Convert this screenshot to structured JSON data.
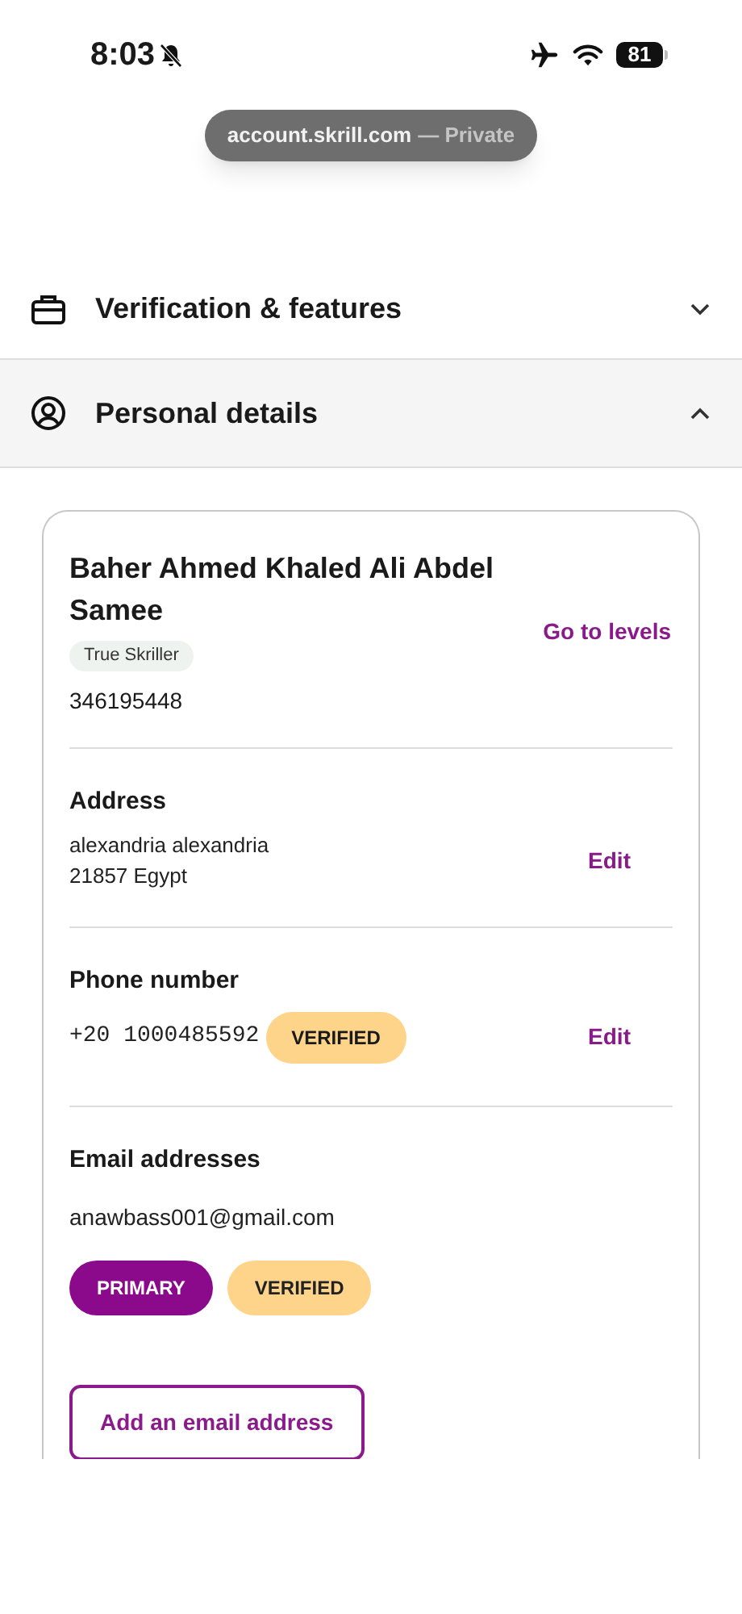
{
  "status_bar": {
    "time": "8:03",
    "battery": "81"
  },
  "url_bar": {
    "domain": "account.skrill.com",
    "mode": "— Private"
  },
  "sections": [
    {
      "title": "Verification & features",
      "expanded": false
    },
    {
      "title": "Personal details",
      "expanded": true
    }
  ],
  "profile": {
    "name": "Baher Ahmed Khaled Ali Abdel Samee",
    "tier": "True Skriller",
    "account_number": "346195448",
    "link": "Go to levels"
  },
  "address": {
    "heading": "Address",
    "lines": [
      "alexandria alexandria",
      "21857 Egypt"
    ],
    "action": "Edit"
  },
  "phone": {
    "heading": "Phone number",
    "number": "+20 1000485592",
    "badge": "VERIFIED",
    "action": "Edit"
  },
  "email": {
    "heading": "Email addresses",
    "address": "anawbass001@gmail.com",
    "badges": [
      {
        "label": "PRIMARY",
        "kind": "primary"
      },
      {
        "label": "VERIFIED",
        "kind": "verified"
      }
    ],
    "button": "Add an email address"
  }
}
